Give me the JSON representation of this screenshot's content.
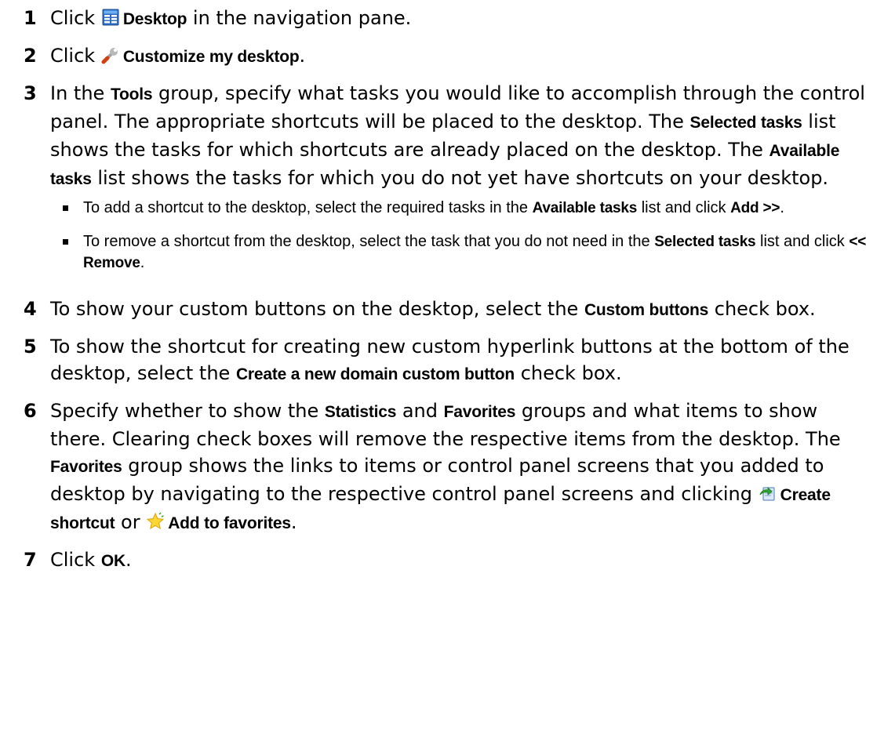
{
  "steps": [
    {
      "number": "1",
      "parts": [
        {
          "t": "text",
          "v": "Click "
        },
        {
          "t": "icon",
          "v": "desktop-icon"
        },
        {
          "t": "ui",
          "v": "Desktop"
        },
        {
          "t": "text",
          "v": " in the navigation pane."
        }
      ]
    },
    {
      "number": "2",
      "parts": [
        {
          "t": "text",
          "v": "Click "
        },
        {
          "t": "icon",
          "v": "wrench-icon"
        },
        {
          "t": "ui",
          "v": "Customize my desktop"
        },
        {
          "t": "text",
          "v": "."
        }
      ]
    },
    {
      "number": "3",
      "parts": [
        {
          "t": "text",
          "v": "In the "
        },
        {
          "t": "ui",
          "v": "Tools"
        },
        {
          "t": "text",
          "v": " group, specify what tasks you would like to accomplish through the control panel. The appropriate shortcuts will be placed to the desktop. The "
        },
        {
          "t": "ui",
          "v": "Selected tasks"
        },
        {
          "t": "text",
          "v": " list shows the tasks for which shortcuts are already placed on the desktop. The "
        },
        {
          "t": "ui",
          "v": "Available tasks"
        },
        {
          "t": "text",
          "v": " list shows the tasks for which you do not yet have shortcuts on your desktop."
        }
      ],
      "bullets": [
        [
          {
            "t": "text",
            "v": "To add a shortcut to the desktop, select the required tasks in the "
          },
          {
            "t": "ui",
            "v": "Available tasks"
          },
          {
            "t": "text",
            "v": " list and click "
          },
          {
            "t": "ui",
            "v": "Add >>"
          },
          {
            "t": "text",
            "v": "."
          }
        ],
        [
          {
            "t": "text",
            "v": "To remove a shortcut from the desktop, select the task that you do not need in the "
          },
          {
            "t": "ui",
            "v": "Selected tasks"
          },
          {
            "t": "text",
            "v": " list and click "
          },
          {
            "t": "ui",
            "v": "<< Remove"
          },
          {
            "t": "text",
            "v": "."
          }
        ]
      ]
    },
    {
      "number": "4",
      "parts": [
        {
          "t": "text",
          "v": "To show your custom buttons on the desktop, select the "
        },
        {
          "t": "ui",
          "v": "Custom buttons"
        },
        {
          "t": "text",
          "v": " check box."
        }
      ]
    },
    {
      "number": "5",
      "parts": [
        {
          "t": "text",
          "v": "To show the shortcut for creating new custom hyperlink buttons at the bottom of the desktop, select the "
        },
        {
          "t": "ui",
          "v": "Create a new domain custom button"
        },
        {
          "t": "text",
          "v": " check box."
        }
      ]
    },
    {
      "number": "6",
      "parts": [
        {
          "t": "text",
          "v": "Specify whether to show the "
        },
        {
          "t": "ui",
          "v": "Statistics"
        },
        {
          "t": "text",
          "v": " and "
        },
        {
          "t": "ui",
          "v": "Favorites"
        },
        {
          "t": "text",
          "v": " groups and what items to show there. Clearing check boxes will remove the respective items from the desktop. The "
        },
        {
          "t": "ui",
          "v": "Favorites"
        },
        {
          "t": "text",
          "v": " group shows the links to items or control panel screens that you added to desktop by navigating to the respective control panel screens and clicking "
        },
        {
          "t": "icon",
          "v": "create-shortcut-icon"
        },
        {
          "t": "ui",
          "v": "Create shortcut"
        },
        {
          "t": "text",
          "v": " or "
        },
        {
          "t": "icon",
          "v": "star-icon"
        },
        {
          "t": "ui",
          "v": "Add to favorites"
        },
        {
          "t": "text",
          "v": "."
        }
      ]
    },
    {
      "number": "7",
      "parts": [
        {
          "t": "text",
          "v": "Click "
        },
        {
          "t": "ui",
          "v": "OK"
        },
        {
          "t": "text",
          "v": "."
        }
      ]
    }
  ]
}
